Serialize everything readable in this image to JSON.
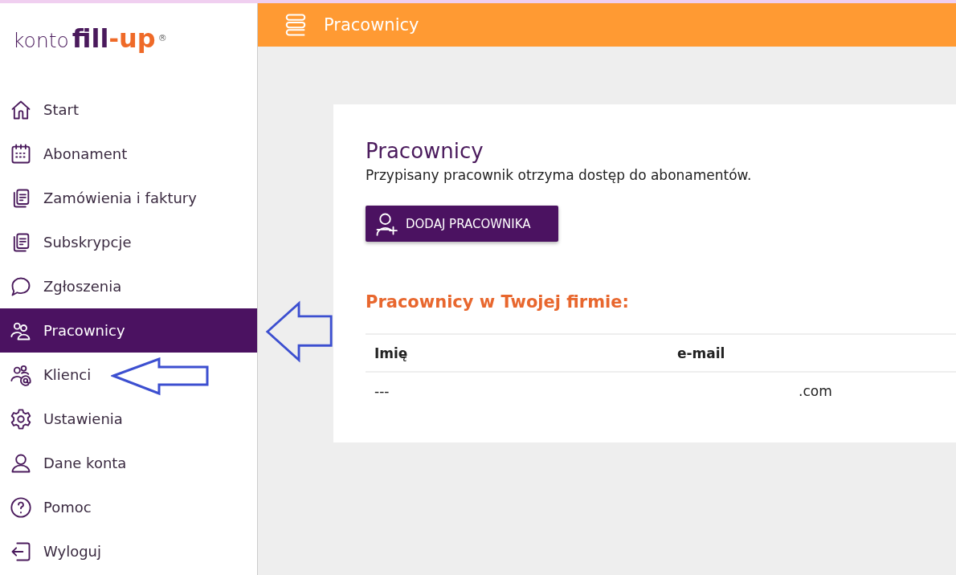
{
  "logo": {
    "prefix": "konto",
    "brand_first": "fill",
    "separator": "-",
    "brand_second": "up",
    "mark": "®"
  },
  "sidebar": {
    "items": [
      {
        "label": "Start",
        "selected": false
      },
      {
        "label": "Abonament",
        "selected": false
      },
      {
        "label": "Zamówienia i faktury",
        "selected": false
      },
      {
        "label": "Subskrypcje",
        "selected": false
      },
      {
        "label": "Zgłoszenia",
        "selected": false
      },
      {
        "label": "Pracownicy",
        "selected": true
      },
      {
        "label": "Klienci",
        "selected": false
      },
      {
        "label": "Ustawienia",
        "selected": false
      },
      {
        "label": "Dane konta",
        "selected": false
      },
      {
        "label": "Pomoc",
        "selected": false
      },
      {
        "label": "Wyloguj",
        "selected": false
      }
    ]
  },
  "header": {
    "title": "Pracownicy"
  },
  "card": {
    "title": "Pracownicy",
    "description": "Przypisany pracownik otrzyma dostęp do abonamentów.",
    "add_button": "DODAJ PRACOWNIKA",
    "section_title": "Pracownicy w Twojej firmie:"
  },
  "table": {
    "columns": [
      "Imię",
      "e-mail"
    ],
    "rows": [
      [
        "---",
        ".com"
      ]
    ]
  }
}
